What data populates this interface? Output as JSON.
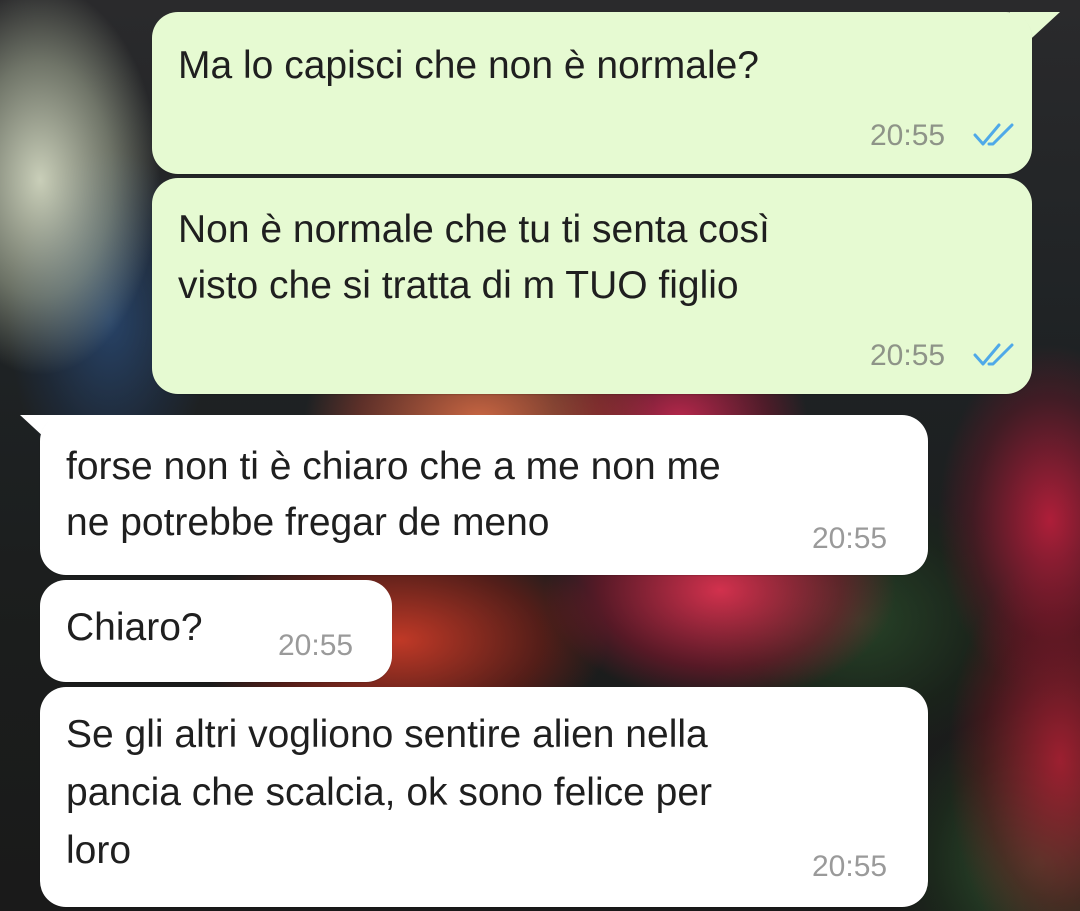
{
  "messages": [
    {
      "direction": "outgoing",
      "lines": [
        "Ma lo capisci che non è normale?"
      ],
      "time": "20:55",
      "read_ticks": "double-check-read-icon"
    },
    {
      "direction": "outgoing",
      "lines": [
        "Non è normale che tu ti senta così",
        "visto che si tratta di m TUO figlio"
      ],
      "time": "20:55",
      "read_ticks": "double-check-read-icon"
    },
    {
      "direction": "incoming",
      "lines": [
        "forse non ti è chiaro che a me non me",
        "ne potrebbe fregar de meno"
      ],
      "time": "20:55"
    },
    {
      "direction": "incoming",
      "lines": [
        "Chiaro?"
      ],
      "time": "20:55"
    },
    {
      "direction": "incoming",
      "lines": [
        "Se gli altri vogliono sentire alien nella",
        "pancia che scalcia, ok sono felice per",
        "loro"
      ],
      "time": "20:55"
    }
  ],
  "colors": {
    "outgoing_bubble": "#e6fad2",
    "incoming_bubble": "#ffffff",
    "read_tick": "#4fa9e8",
    "timestamp": "#8e9488"
  }
}
